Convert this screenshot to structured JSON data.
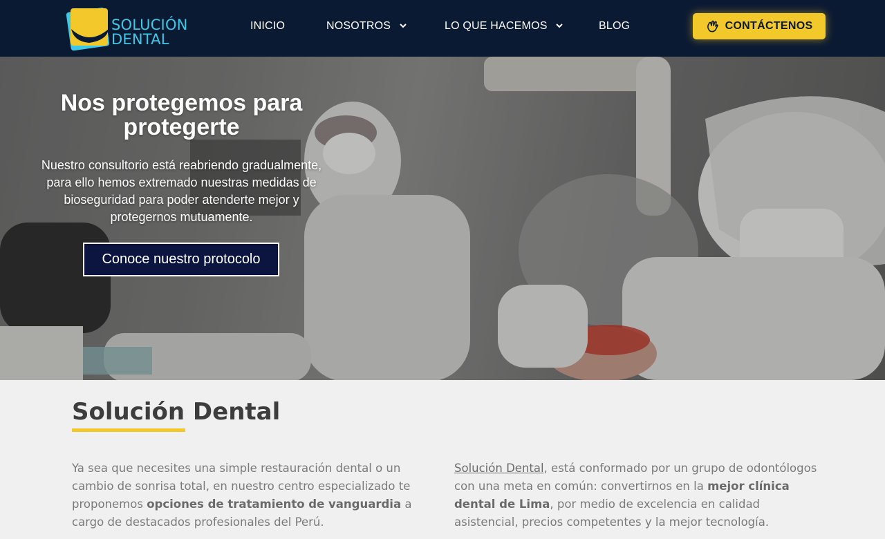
{
  "brand": {
    "name_line1": "SOLUCIÓN",
    "name_line2": "DENTAL",
    "colors": {
      "navy": "#0b1a33",
      "yellow": "#f3c82a",
      "cyan": "#3ec8e6"
    }
  },
  "nav": {
    "items": [
      {
        "label": "INICIO",
        "has_dropdown": false
      },
      {
        "label": "NOSOTROS",
        "has_dropdown": true
      },
      {
        "label": "LO QUE HACEMOS",
        "has_dropdown": true
      },
      {
        "label": "BLOG",
        "has_dropdown": false
      }
    ],
    "cta_label": "CONTÁCTENOS",
    "cta_icon": "waving-hand-icon"
  },
  "hero": {
    "title": "Nos protegemos para protegerte",
    "text": "Nuestro consultorio está reabriendo gradualmente, para ello hemos extremado nuestras medidas de bioseguridad para poder atenderte mejor y protegernos mutuamente.",
    "button_label": "Conoce nuestro protocolo"
  },
  "intro": {
    "title": "Solución Dental",
    "left": {
      "part1": "Ya sea que necesites una simple restauración dental o un cambio de sonrisa total, en nuestro centro especializado te proponemos ",
      "bold": "opciones de tratamiento de vanguardia",
      "part2": " a cargo de destacados profesionales del Perú."
    },
    "right": {
      "link": "Solución Dental",
      "part1": ", está conformado por un grupo de odontólogos con una meta en común: convertirnos en la ",
      "bold": "mejor clínica dental de Lima",
      "part2": ", por medio de excelencia en calidad asistencial, precios competentes y la mejor tecnología."
    }
  }
}
